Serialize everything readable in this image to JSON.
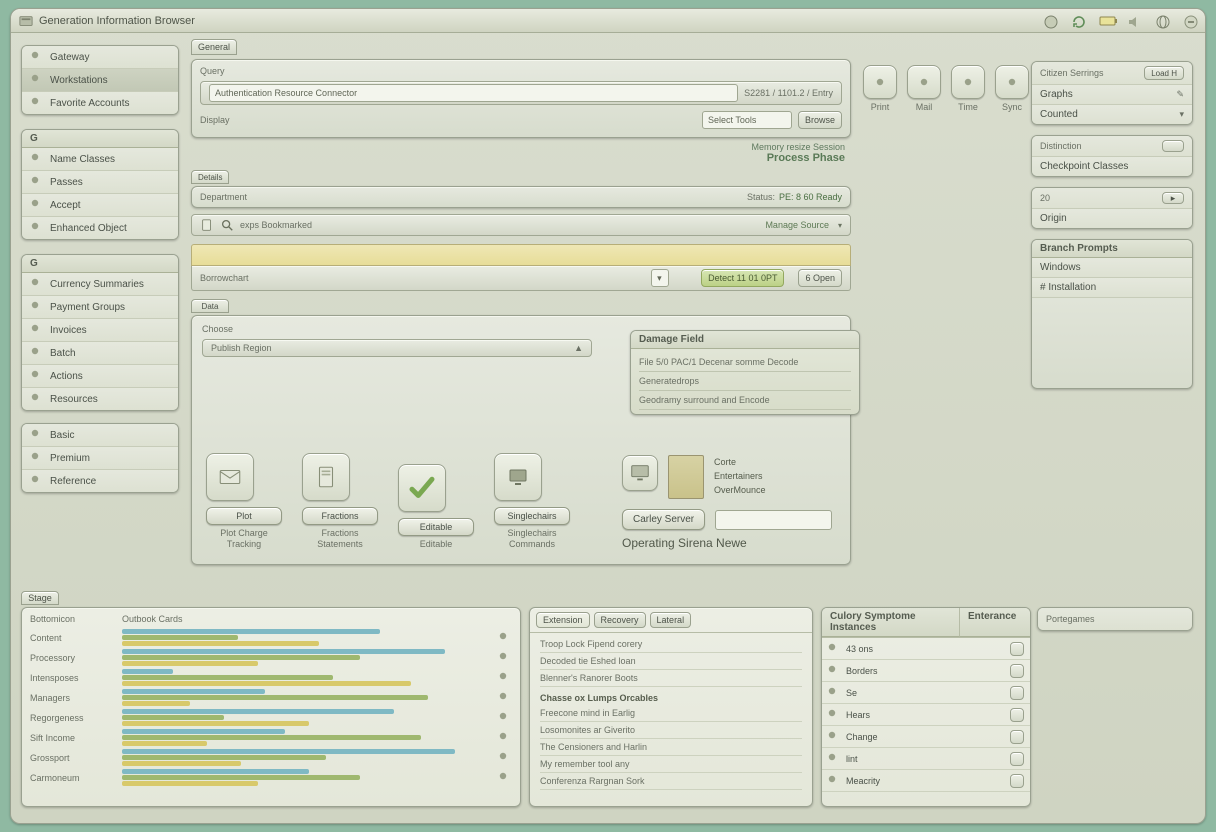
{
  "titlebar": {
    "title": "Generation Information Browser"
  },
  "tray": {
    "icons": [
      "disk-icon",
      "refresh-icon",
      "battery-icon",
      "sound-icon",
      "network-icon",
      "close-icon"
    ]
  },
  "leftTop": {
    "items": [
      {
        "name": "sidebar-item-gateway",
        "label": "Gateway"
      },
      {
        "name": "sidebar-item-workstations",
        "label": "Workstations",
        "sel": true
      },
      {
        "name": "sidebar-item-favorites",
        "label": "Favorite Accounts"
      }
    ]
  },
  "leftMid": {
    "hdr": "G",
    "items": [
      {
        "name": "sidebar-item-names",
        "label": "Name Classes"
      },
      {
        "name": "sidebar-item-passes",
        "label": "Passes"
      },
      {
        "name": "sidebar-item-accept",
        "label": "Accept"
      },
      {
        "name": "sidebar-item-enhanced",
        "label": "Enhanced Object"
      }
    ]
  },
  "leftNav": {
    "hdr": "G",
    "items": [
      {
        "name": "sidebar-item-currency",
        "label": "Currency Summaries"
      },
      {
        "name": "sidebar-item-payment",
        "label": "Payment Groups"
      },
      {
        "name": "sidebar-item-invoices",
        "label": "Invoices"
      },
      {
        "name": "sidebar-item-batch",
        "label": "Batch"
      },
      {
        "name": "sidebar-item-actions",
        "label": "Actions"
      },
      {
        "name": "sidebar-item-resources",
        "label": "Resources"
      }
    ]
  },
  "leftTags": {
    "items": [
      {
        "name": "tag-basic",
        "label": "Basic"
      },
      {
        "name": "tag-premium",
        "label": "Premium"
      },
      {
        "name": "tag-reference",
        "label": "Reference"
      }
    ]
  },
  "mainTabs": [
    "General"
  ],
  "header": {
    "label": "Query",
    "value": "Authentication Resource Connector",
    "right": "S2281 / 1101.2 / Entry"
  },
  "pickerRow": {
    "label": "Display",
    "select": "Select Tools",
    "btn": "Browse"
  },
  "quickIcons": [
    {
      "name": "qi-print",
      "label": "Print"
    },
    {
      "name": "qi-comment",
      "label": "Mail"
    },
    {
      "name": "qi-schedule",
      "label": "Time"
    },
    {
      "name": "qi-refresh",
      "label": "Sync"
    }
  ],
  "infoA": {
    "a": "Memory resize Session",
    "b": "Process Phase"
  },
  "section2": {
    "tab": "Details",
    "label": "Department",
    "status_l": "Status:",
    "status_v": "PE: 8 60 Ready"
  },
  "toolbarRow": {
    "icons": [
      "file-icon",
      "search-icon"
    ],
    "crumb": "exps   Bookmarked",
    "link": "Manage Source"
  },
  "filterBar": {
    "label": "Borrowchart",
    "pill1": "Detect  11 01 0PT",
    "pill2": "6   Open"
  },
  "section3": {
    "tab": "Data",
    "l1": "Choose",
    "l2": "Publish Region"
  },
  "popup": {
    "title": "Damage Field",
    "lines": [
      "File 5/0 PAC/1 Decenar somme Decode",
      "Generatedrops",
      "Geodramy surround and Encode"
    ]
  },
  "launchers": [
    {
      "name": "app-plot",
      "label": "Plot Charge Tracking",
      "svg": "envelope"
    },
    {
      "name": "app-status",
      "label": "Fractions Statements",
      "svg": "doc"
    },
    {
      "name": "app-edit",
      "label": "Editable",
      "svg": "check"
    },
    {
      "name": "app-commands",
      "label": "Singlechairs Commands",
      "svg": "monitor"
    }
  ],
  "serverBtn": {
    "label": "Carley Server"
  },
  "serverStack": [
    "Corte",
    "Entertainers",
    "OverMounce"
  ],
  "serverCaption": "Operating Sirena Newe",
  "rightA": {
    "title": "Citizen Serrings",
    "btn": "Load H",
    "l1": "Graphs",
    "l2": "Counted"
  },
  "rightB": {
    "title": "Distinction",
    "btn": "",
    "row": "Checkpoint Classes"
  },
  "rightC": {
    "a": "20",
    "btn": "",
    "row": "Origin"
  },
  "rightD": {
    "title": "Branch Prompts",
    "rows": [
      "Windows",
      "#  Installation"
    ]
  },
  "bottomTab": "Stage",
  "bl": {
    "a": "Bottomicon",
    "b": "Outbook Cards",
    "rows": [
      "Content",
      "Processory",
      "Intensposes",
      "Managers",
      "Regorgeness",
      "Sift Income",
      "Grossport",
      "Carmoneum"
    ]
  },
  "chart_data": {
    "type": "bar",
    "categories": [
      "Content",
      "Processory",
      "Intensposes",
      "Managers",
      "Regorgeness",
      "Sift Income",
      "Grossport",
      "Carmoneum"
    ],
    "series": [
      {
        "name": "a",
        "values": [
          76,
          95,
          15,
          42,
          80,
          48,
          98,
          55
        ],
        "color": "#7fb9c4"
      },
      {
        "name": "b",
        "values": [
          34,
          70,
          62,
          90,
          30,
          88,
          60,
          70
        ],
        "color": "#9fb86f"
      },
      {
        "name": "c",
        "values": [
          58,
          40,
          85,
          20,
          55,
          25,
          35,
          40
        ],
        "color": "#d8c96a"
      }
    ],
    "xlim": [
      0,
      100
    ]
  },
  "bm": {
    "tabs": [
      "Extension",
      "Recovery",
      "Lateral"
    ],
    "group1": [
      "Troop Lock Fipend corery",
      "Decoded tie Eshed loan",
      "Blenner's Ranorer Boots"
    ],
    "g2title": "Chasse ox Lumps Orcables",
    "group2": [
      "Freecone mind in Earlig",
      "Losomonites ar Giverito",
      "The Censioners and Harlin",
      "My remember tool any",
      "Conferenza Rargnan Sork"
    ]
  },
  "br": {
    "title": "Culory Symptome Instances",
    "c2": "Enterance",
    "rows": [
      "43 ons",
      "Borders",
      "Se",
      "Hears",
      "Change",
      "lint",
      "Meacrity"
    ]
  },
  "brPanel": "Portegames"
}
